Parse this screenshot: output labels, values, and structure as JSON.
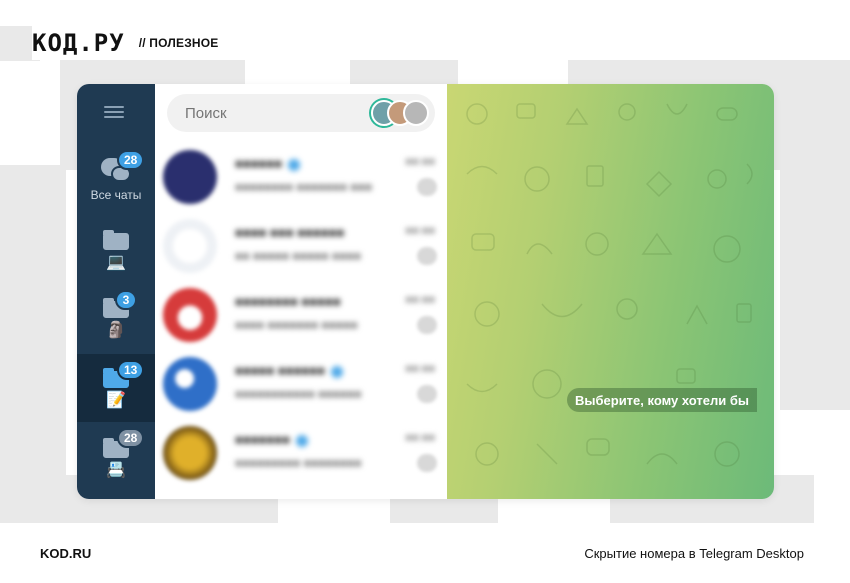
{
  "header": {
    "logo": "КОД.РУ",
    "rubric": "// ПОЛЕЗНОЕ"
  },
  "app": {
    "rail": {
      "menu_icon": "hamburger-icon",
      "folders": [
        {
          "icon": "chat-bubbles-icon",
          "label": "Все чаты",
          "badge": "28",
          "badge_color": "#3ea0e4"
        },
        {
          "icon": "folder-icon",
          "emoji": "💻",
          "badge": ""
        },
        {
          "icon": "folder-icon",
          "emoji": "🗿",
          "badge": "3",
          "badge_color": "#3ea0e4"
        },
        {
          "icon": "folder-icon",
          "emoji": "📝",
          "badge": "13",
          "badge_color": "#3ea0e4",
          "active": true
        },
        {
          "icon": "folder-icon",
          "emoji": "📇",
          "badge": "28",
          "badge_color": "#7f91a3"
        }
      ]
    },
    "search": {
      "placeholder": "Поиск",
      "stories_icon": "stories-avatars-icon"
    },
    "chats": [
      {
        "title": "■■■■■■",
        "preview": "■■■■■■■■ ■■■■■■■ ■■■",
        "time": "■■:■■",
        "verified": true,
        "avatar_color": "#2a2f6e"
      },
      {
        "title": "■■■■ ■■■ ■■■■■■",
        "preview": "■■ ■■■■■ ■■■■■ ■■■■",
        "time": "■■:■■",
        "verified": false,
        "avatar_color": "#7a8fa8"
      },
      {
        "title": "■■■■■■■■ ■■■■■",
        "preview": "■■■■ ■■■■■■■ ■■■■■",
        "time": "■■:■■",
        "verified": false,
        "avatar_color": "#d63b3b"
      },
      {
        "title": "■■■■■ ■■■■■■",
        "preview": "■■■■■■■■■■■ ■■■■■■",
        "time": "■■:■■",
        "verified": true,
        "avatar_color": "#2f6fc8"
      },
      {
        "title": "■■■■■■■",
        "preview": "■■■■■■■■■ ■■■■■■■■",
        "time": "■■:■■",
        "verified": true,
        "avatar_color": "#b58a1e"
      }
    ],
    "chat_area": {
      "placeholder_pill": "Выберите, кому хотели бы"
    }
  },
  "footer": {
    "left": "KOD.RU",
    "right": "Скрытие номера в Telegram Desktop"
  },
  "colors": {
    "rail": "#1f3a52",
    "rail_active": "#152b3e",
    "accent": "#3ea0e4",
    "wallpaper_start": "#c9d773",
    "wallpaper_end": "#6cba79"
  }
}
